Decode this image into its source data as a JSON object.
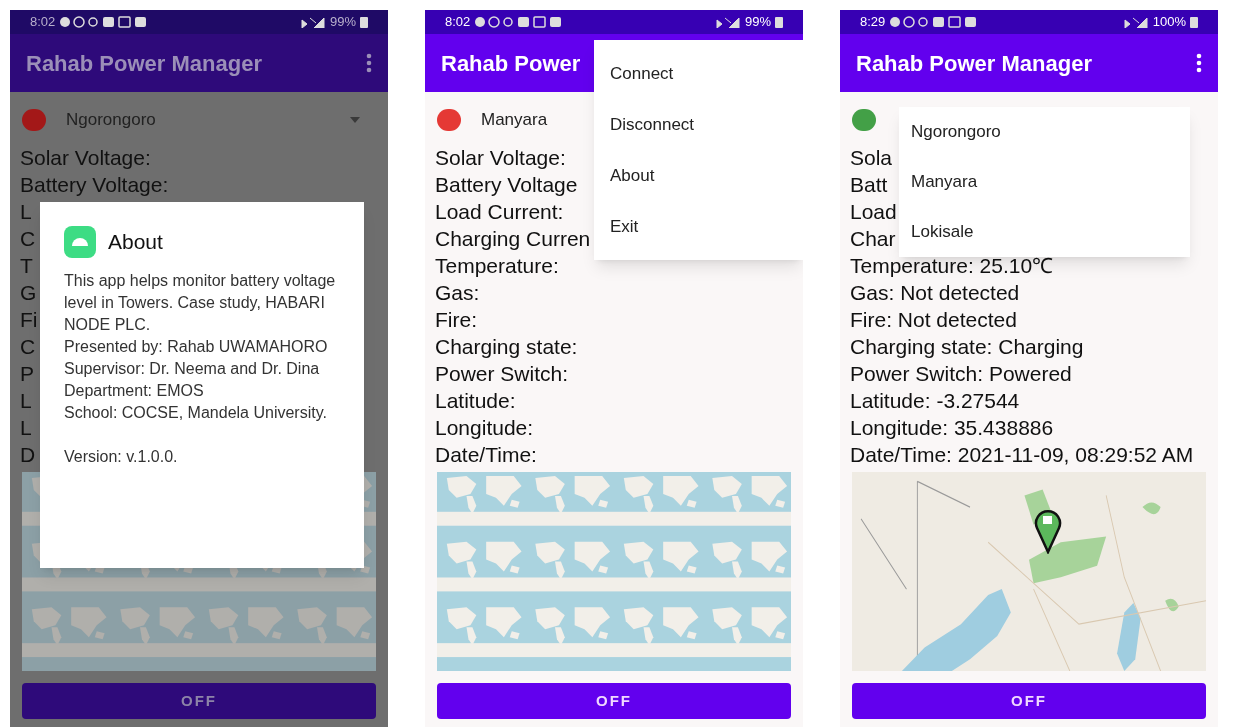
{
  "screens": [
    {
      "status_bar": {
        "time": "8:02",
        "battery": "99%"
      },
      "app_bar": {
        "title": "Rahab Power Manager"
      },
      "station": {
        "name": "Ngorongoro",
        "color": "#a31818"
      },
      "dimmed": true,
      "fields": [
        "Solar Voltage:",
        "Battery Voltage:",
        "L",
        "C",
        "T",
        "G",
        "Fi",
        "C",
        "P",
        "L",
        "L",
        "D"
      ],
      "map": {
        "kind": "world_tiles"
      },
      "button": "OFF",
      "dialog": {
        "title": "About",
        "lines": [
          "This app helps monitor battery voltage level in Towers. Case study, HABARI NODE PLC.",
          "Presented by: Rahab UWAMAHORO",
          "Supervisor: Dr. Neema and Dr. Dina",
          "Department: EMOS",
          "School: COCSE, Mandela University."
        ],
        "version": "Version: v.1.0.0."
      }
    },
    {
      "status_bar": {
        "time": "8:02",
        "battery": "99%"
      },
      "app_bar": {
        "title": "Rahab Power"
      },
      "station": {
        "name": "Manyara",
        "color": "#e53935"
      },
      "dimmed": false,
      "fields": [
        "Solar Voltage:",
        "Battery Voltage",
        "Load Current:",
        "Charging Curren",
        "Temperature:",
        "Gas:",
        "Fire:",
        "Charging state:",
        "Power Switch:",
        "Latitude:",
        "Longitude:",
        "Date/Time:"
      ],
      "map": {
        "kind": "world_tiles"
      },
      "button": "OFF",
      "menu": [
        "Connect",
        "Disconnect",
        "About",
        "Exit"
      ]
    },
    {
      "status_bar": {
        "time": "8:29",
        "battery": "100%"
      },
      "app_bar": {
        "title": "Rahab Power Manager"
      },
      "station": {
        "color": "#43a047"
      },
      "dimmed": false,
      "fields": [
        "Sola",
        "Batt",
        "Load",
        "Char",
        "Temperature: 25.10℃",
        "Gas: Not detected",
        "Fire: Not detected",
        "Charging state: Charging",
        "Power Switch: Powered",
        "Latitude: -3.27544",
        "Longitude: 35.438886",
        "Date/Time: 2021-11-09, 08:29:52 AM"
      ],
      "map": {
        "kind": "terrain"
      },
      "button": "OFF",
      "dropdown": [
        "Ngorongoro",
        "Manyara",
        "Lokisale"
      ]
    }
  ]
}
